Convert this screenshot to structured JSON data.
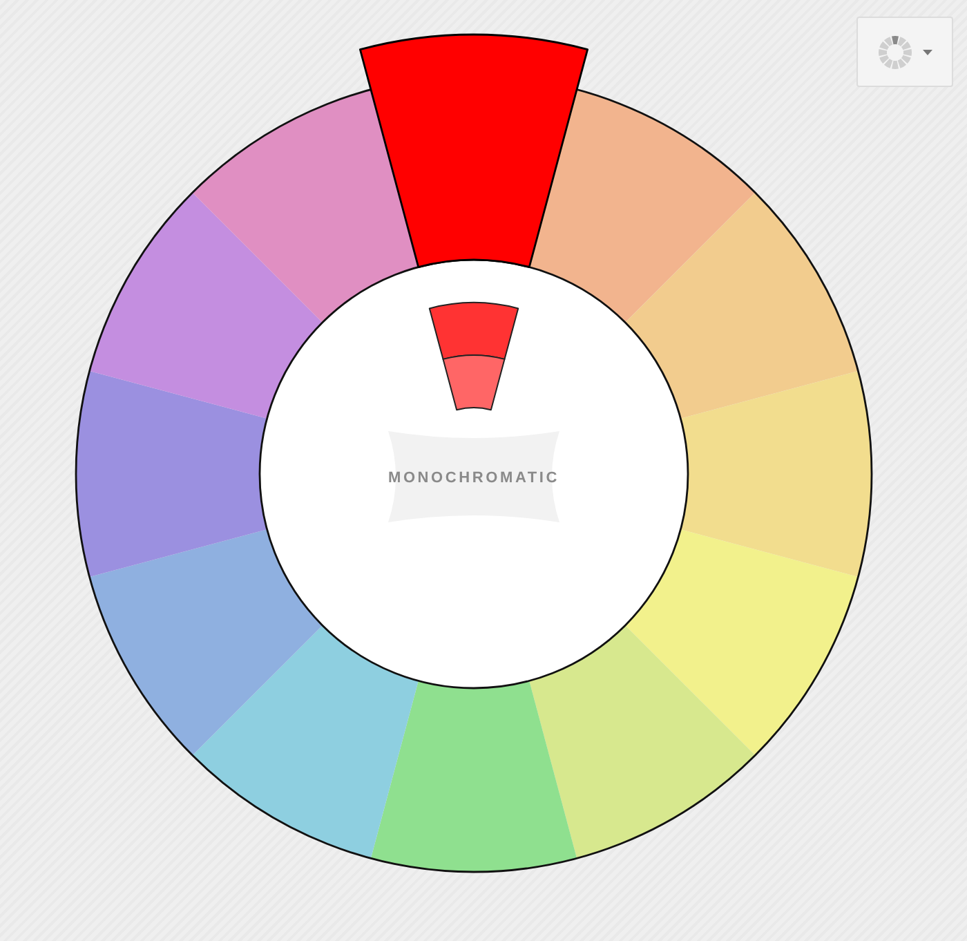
{
  "wheel": {
    "segments": [
      {
        "color": "#ff0000",
        "selected": true
      },
      {
        "color": "#f2b48e",
        "selected": false
      },
      {
        "color": "#f2cc8e",
        "selected": false
      },
      {
        "color": "#f2dd8e",
        "selected": false
      },
      {
        "color": "#f2f18c",
        "selected": false
      },
      {
        "color": "#d7e88e",
        "selected": false
      },
      {
        "color": "#8fe08f",
        "selected": false
      },
      {
        "color": "#8ecfe0",
        "selected": false
      },
      {
        "color": "#8fb0e0",
        "selected": false
      },
      {
        "color": "#9b90e0",
        "selected": false
      },
      {
        "color": "#c48ee0",
        "selected": false
      },
      {
        "color": "#e08fc2",
        "selected": false
      }
    ]
  },
  "center": {
    "label": "MONOCHROMATIC",
    "shades": [
      {
        "color": "#ff3333"
      },
      {
        "color": "#ff6666"
      }
    ]
  }
}
